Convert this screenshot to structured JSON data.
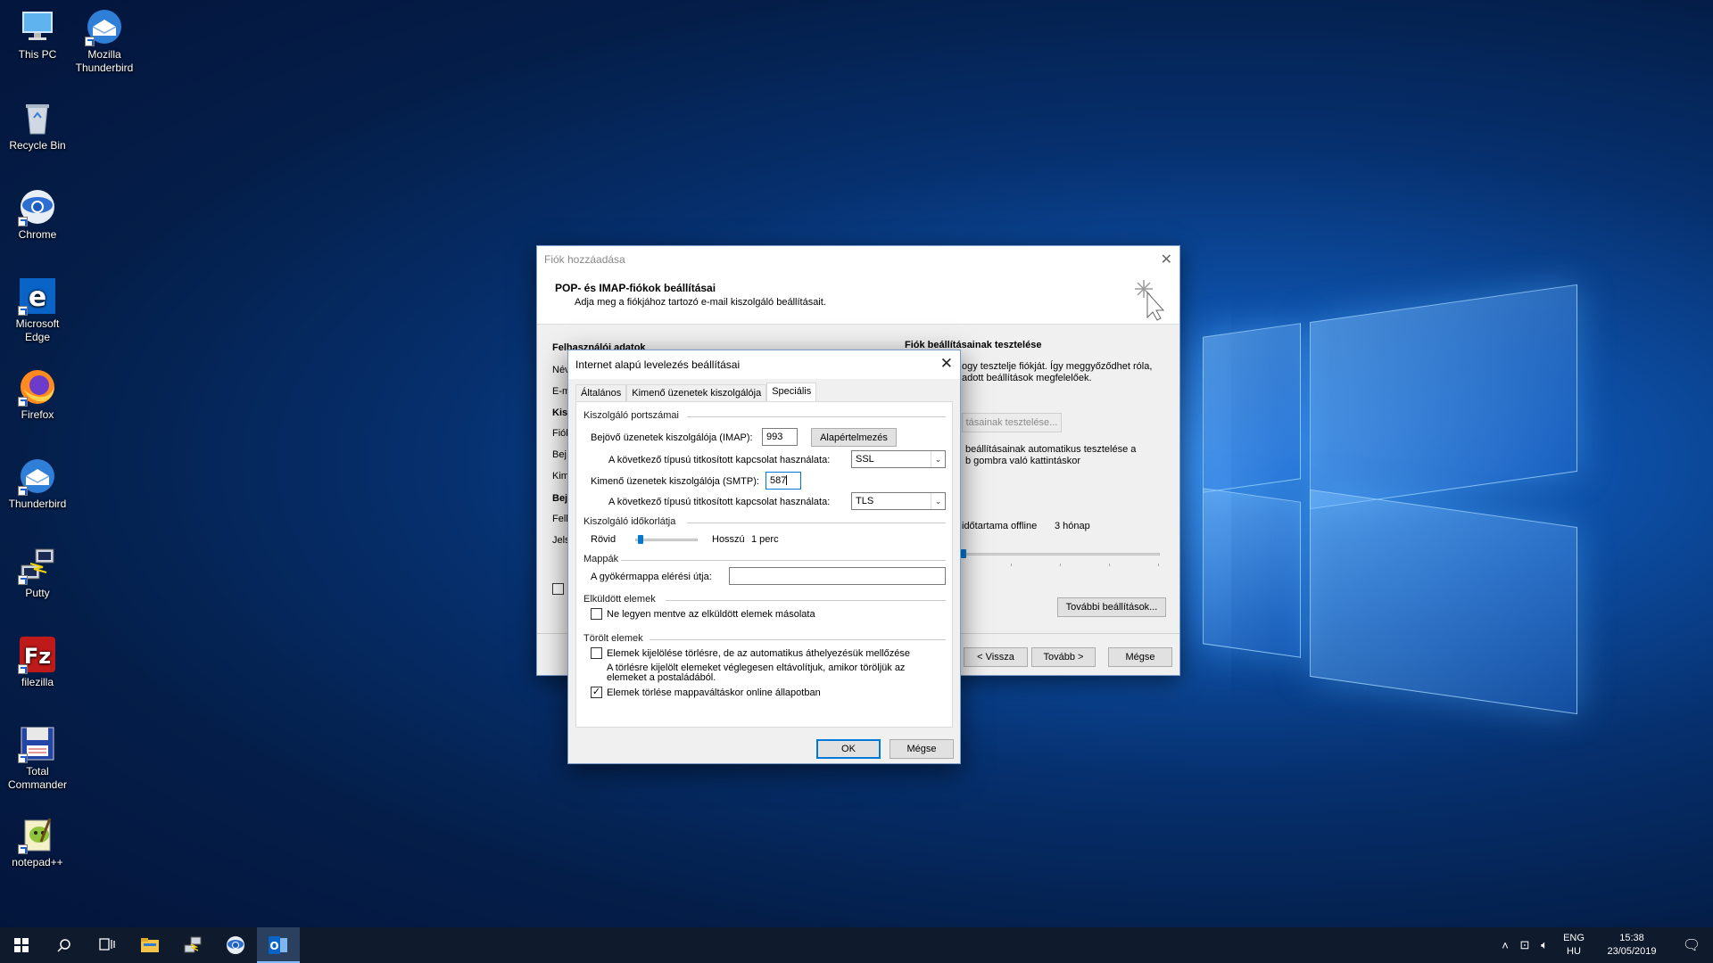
{
  "desktop": {
    "icons": [
      {
        "label": "This PC",
        "icon": "computer-icon"
      },
      {
        "label": "Mozilla\nThunderbird",
        "icon": "thunderbird-icon"
      },
      {
        "label": "Recycle Bin",
        "icon": "recycle-bin-icon"
      },
      {
        "label": "Chrome",
        "icon": "chrome-icon"
      },
      {
        "label": "Microsoft\nEdge",
        "icon": "edge-icon"
      },
      {
        "label": "Firefox",
        "icon": "firefox-icon"
      },
      {
        "label": "Thunderbird",
        "icon": "thunderbird-icon"
      },
      {
        "label": "Putty",
        "icon": "putty-icon"
      },
      {
        "label": "filezilla",
        "icon": "filezilla-icon"
      },
      {
        "label": "Total\nCommander",
        "icon": "total-commander-icon"
      },
      {
        "label": "notepad++",
        "icon": "notepad-plus-plus-icon"
      }
    ]
  },
  "main_dialog": {
    "title": "Fiók hozzáadása",
    "header_title": "POP- és IMAP-fiókok beállításai",
    "header_subtitle": "Adja meg a fiókjához tartozó e-mail kiszolgáló beállításait.",
    "left_fragments": [
      "Felhasználói adatok",
      "Név",
      "E-m",
      "Kisz",
      "Fiók",
      "Bej",
      "Kim",
      "Bej",
      "Fell",
      "Jels"
    ],
    "right_title": "Fiók beállításainak tesztelése",
    "right_text_1": "ogy tesztelje fiókját. Így meggyőződhet róla,",
    "right_text_2": "adott beállítások megfelelőek.",
    "test_button": "tásainak tesztelése...",
    "auto_test_1": "beállításainak automatikus tesztelése a",
    "auto_test_2": "b gombra való kattintáskor",
    "offline_label": "időtartama offline",
    "offline_value": "3 hónap",
    "more_settings": "További beállítások...",
    "back": "< Vissza",
    "next": "Tovább >",
    "cancel": "Mégse"
  },
  "sub_dialog": {
    "title": "Internet alapú levelezés beállításai",
    "tabs": [
      "Általános",
      "Kimenő üzenetek kiszolgálója",
      "Speciális"
    ],
    "active_tab": "Speciális",
    "groups": {
      "ports": "Kiszolgáló portszámai",
      "timeout": "Kiszolgáló időkorlátja",
      "folders": "Mappák",
      "sent": "Elküldött elemek",
      "deleted": "Törölt elemek"
    },
    "imap_label": "Bejövő üzenetek kiszolgálója (IMAP):",
    "imap_port": "993",
    "default_button": "Alapértelmezés",
    "encryption_label": "A következő típusú titkosított kapcsolat használata:",
    "imap_encryption": "SSL",
    "smtp_label": "Kimenő üzenetek kiszolgálója (SMTP):",
    "smtp_port": "587",
    "smtp_encryption": "TLS",
    "timeout_short": "Rövid",
    "timeout_long": "Hosszú",
    "timeout_value": "1 perc",
    "timeout_level": 0.05,
    "root_folder_label": "A gyökérmappa elérési útja:",
    "root_folder_value": "",
    "sent_checkbox": "Ne legyen mentve az elküldött elemek másolata",
    "sent_checked": false,
    "mark_delete_checkbox": "Elemek kijelölése törlésre, de az automatikus áthelyezésük mellőzése",
    "mark_delete_checked": false,
    "mark_delete_note_1": "A törlésre kijelölt elemeket véglegesen eltávolítjuk, amikor töröljük az",
    "mark_delete_note_2": "elemeket a postaládából.",
    "purge_checkbox": "Elemek törlése mappaváltáskor online állapotban",
    "purge_checked": true,
    "ok": "OK",
    "cancel": "Mégse"
  },
  "taskbar": {
    "items": [
      "start-icon",
      "search-icon",
      "task-view-icon",
      "file-explorer-icon",
      "network-app-icon",
      "chrome-icon",
      "outlook-icon"
    ],
    "lang_1": "ENG",
    "lang_2": "HU",
    "time": "15:38",
    "date": "23/05/2019"
  },
  "colors": {
    "accent": "#0078d7",
    "taskbar": "#0f1a2c"
  }
}
